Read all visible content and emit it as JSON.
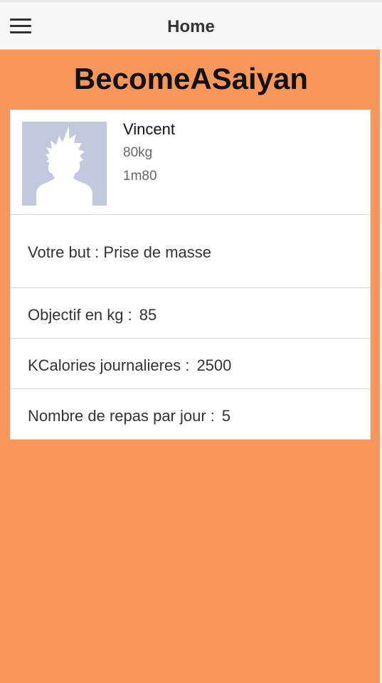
{
  "topbar": {
    "menu_icon": "hamburger-menu-icon",
    "title": "Home"
  },
  "app": {
    "title": "BecomeASaiyan"
  },
  "profile": {
    "avatar_icon": "saiyan-silhouette-icon",
    "name": "Vincent",
    "weight": "80kg",
    "height": "1m80"
  },
  "goal": {
    "label": "Votre but : Prise de masse"
  },
  "stats": {
    "objective_label": "Objectif en kg :",
    "objective_value": "85",
    "kcal_label": "KCalories journalieres :",
    "kcal_value": "2500",
    "meals_label": "Nombre de repas par jour :",
    "meals_value": "5"
  },
  "colors": {
    "background": "#f9975a",
    "card": "#ffffff",
    "topbar": "#f7f7f7",
    "avatar": "#c3c9dc"
  }
}
